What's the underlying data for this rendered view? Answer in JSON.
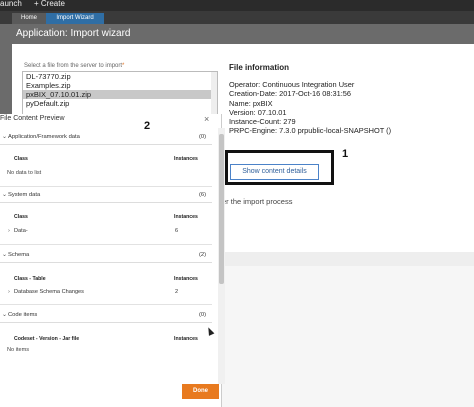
{
  "topbar": {
    "launch_label": "aunch",
    "create_label": "+ Create"
  },
  "tabs": [
    {
      "label": "Home"
    },
    {
      "label": "Import Wizard"
    }
  ],
  "title": "Application: Import wizard",
  "file_select": {
    "label": "Select a file from the server to import",
    "required_mark": "*",
    "files": [
      "DL-73770.zip",
      "Examples.zip",
      "pxBIX_07.10.01.zip",
      "pyDefault.zip"
    ],
    "selected_index": 2
  },
  "file_information": {
    "heading": "File information",
    "lines": [
      "Operator: Continuous Integration User",
      "Creation-Date: 2017-Oct-16 08:31:56",
      "Name: pxBIX",
      "Version: 07.10.01",
      "Instance-Count: 279",
      "PRPC-Engine: 7.3.0 prpublic-local-SNAPSHOT ()"
    ],
    "show_button": "Show content details",
    "import_note": "er the import process"
  },
  "markers": {
    "one": "1",
    "two": "2"
  },
  "preview": {
    "title": "File Content Preview",
    "close_glyph": "×",
    "done_label": "Done",
    "sections": [
      {
        "title": "Application/Framework data",
        "count": "(0)",
        "col_a": "Class",
        "col_b": "Instances",
        "rows": [],
        "empty": "No data to list"
      },
      {
        "title": "System data",
        "count": "(6)",
        "col_a": "Class",
        "col_b": "Instances",
        "rows": [
          {
            "name": "Data-",
            "value": "6"
          }
        ],
        "empty": ""
      },
      {
        "title": "Schema",
        "count": "(2)",
        "col_a": "Class - Table",
        "col_b": "Instances",
        "rows": [
          {
            "name": "Database Schema Changes",
            "value": "2"
          }
        ],
        "empty": ""
      },
      {
        "title": "Code items",
        "count": "(0)",
        "col_a": "Codeset - Version - Jar file",
        "col_b": "Instances",
        "rows": [],
        "empty": "No items"
      }
    ]
  },
  "icons": {
    "chevron": "chevron-down-icon",
    "expand": "chevron-right-icon",
    "close": "close-icon"
  },
  "colors": {
    "accent": "#e87a1f",
    "tab_active": "#2f6ea5",
    "title_bar": "#6b6b6b"
  }
}
